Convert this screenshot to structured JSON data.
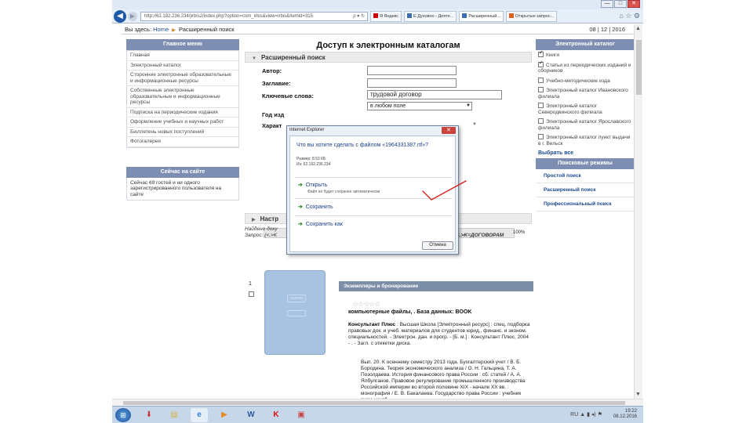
{
  "browser": {
    "address": "http://62.192.236.234/jirbis2/index.php?option=com_irbis&view=irbis&Itemid=315",
    "address_icons": "ρ ▾ ↻",
    "tabs": [
      {
        "label": "Я Яндекс",
        "icon_color": "#cc0000"
      },
      {
        "label": "Е Духовно - Деяте...",
        "icon_color": "#3a6fb0"
      },
      {
        "label": "Расширенный...",
        "icon_color": "#3a6fb0"
      },
      {
        "label": "Открытые запрос...",
        "icon_color": "#e06020"
      }
    ],
    "toolbar_icons": "⌂ ☆ ⚙",
    "window_buttons": [
      "—",
      "□",
      "✕"
    ]
  },
  "breadcrumb": {
    "prefix": "Вы здесь:",
    "home": "Home",
    "current": "Расширенный поиск",
    "date": "08 | 12 | 2016"
  },
  "left_menu": {
    "title": "Главное меню",
    "items": [
      "Главная",
      "Электронный каталог",
      "Сторонние электронные образовательные и информационные ресурсы",
      "Собственные электронные образовательные и информационные ресурсы",
      "Подписка на периодические издания",
      "Оформление учебных и научных работ",
      "Бюллетень новых поступлений",
      "Фотогалерея"
    ]
  },
  "online": {
    "title": "Сейчас на сайте",
    "text": "Сейчас 69 гостей и ни одного зарегистрированного пользователя на сайте"
  },
  "main": {
    "title": "Доступ к электронным каталогам",
    "section": "Расширенный поиск",
    "fields": {
      "author_label": "Автор:",
      "title_label": "Заглавие:",
      "keywords_label": "Ключевые слова:",
      "keywords_value": "трудовой договор",
      "year_label": "Год изд",
      "year_value": "в любом поле",
      "char_label": "Характ"
    },
    "settings_section": "Настр",
    "progress_text": "100%"
  },
  "results": {
    "found_line1": "Найдено доку",
    "found_line2": "Запрос: (<.>K",
    "found_right": "<.>K=ДОГОВОРАМ",
    "index": "1",
    "ex_bar": "Экземпляры и бронирование",
    "cover_label": "сканер",
    "stars": "☆☆☆☆☆",
    "book_title": "компьютерные файлы, . База данных: BOOK",
    "desc_bold": "Консультант Плюс",
    "desc_text": " : Высшая Школа [Электронный ресурс] : спец. подборка правовых док. и учеб. материалов для студентов юрид., финанс. и эконом. специальностей. - Электрон. дан. и прогр. - [Б. м.] : Консультант Плюс, 2004 - . - Загл. с этикетки диска.",
    "more_text": "Вып. 20. К осеннему семестру 2013 года. Бухгалтерский учет / В. Б. Бородина. Теория экономического анализа / О. Н. Гальцина, Т. А. Позолдаева. История финансового права России : сб. статей / А. А. Ялбулганов. Правовое регулирование промышленного производства Российской империи во второй половине XIX - начале XX вв. : монография / Е. В. Бакалаева. Государство права России : учебник схем : учеб."
  },
  "right_catalog": {
    "title": "Электронный каталог",
    "items": [
      {
        "label": "Книги",
        "checked": true
      },
      {
        "label": "Статьи из периодических изданий и сборников",
        "checked": true
      },
      {
        "label": "Учебно-методические изда",
        "checked": false
      },
      {
        "label": "Электронный каталог Ивановского филиала",
        "checked": false
      },
      {
        "label": "Электронный каталог Северодвинского филиала",
        "checked": false
      },
      {
        "label": "Электронный каталог Ярославского филиала",
        "checked": false
      },
      {
        "label": "Электронный каталог пункт выдачи в г. Вельск",
        "checked": false
      }
    ],
    "select_all": "Выбрать все"
  },
  "search_modes": {
    "title": "Поисковые режимы",
    "items": [
      "Простой поиск",
      "Расширенный поиск",
      "Профессиональный поиск"
    ]
  },
  "dialog": {
    "title": "Internet Explorer",
    "question": "Что вы хотите сделать с файлом «1964331387.rtf»?",
    "size": "Размер: 8.53 КБ",
    "from": "Из: 62.192.236.234",
    "open": "Открыть",
    "open_sub": "Файл не будет сохранен автоматически",
    "save": "Сохранить",
    "save_as": "Сохранить как",
    "cancel": "Отмена",
    "close": "✕"
  },
  "taskbar": {
    "lang": "RU",
    "time": "19:22",
    "date": "08.12.2016",
    "tray_icons": "▲ ▮ ◂) ⚑",
    "apps": [
      {
        "glyph": "⬇",
        "color": "#c33"
      },
      {
        "glyph": "▤",
        "color": "#e8c85a"
      },
      {
        "glyph": "e",
        "color": "#2c7fd6"
      },
      {
        "glyph": "▶",
        "color": "#e08a20"
      },
      {
        "glyph": "W",
        "color": "#2b579a"
      },
      {
        "glyph": "K",
        "color": "#d11"
      },
      {
        "glyph": "▣",
        "color": "#c44"
      }
    ]
  }
}
